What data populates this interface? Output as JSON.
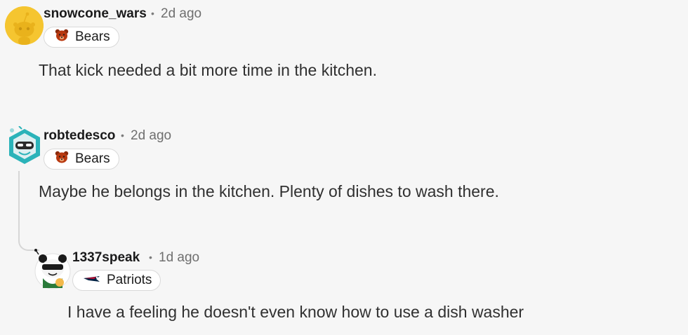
{
  "comments": [
    {
      "username": "snowcone_wars",
      "separator": "•",
      "time": "2d ago",
      "flair": {
        "label": "Bears",
        "icon": "bears-logo-icon",
        "color": "#c83803"
      },
      "body": "That kick needed a bit more time in the kitchen."
    },
    {
      "username": "robtedesco",
      "separator": "•",
      "time": "2d ago",
      "flair": {
        "label": "Bears",
        "icon": "bears-logo-icon",
        "color": "#c83803"
      },
      "body": "Maybe he belongs in the kitchen. Plenty of dishes to wash there."
    },
    {
      "username": "1337speak",
      "separator": "•",
      "time": "1d ago",
      "flair": {
        "label": "Patriots",
        "icon": "patriots-logo-icon",
        "color": "#002244"
      },
      "body": "I have a feeling he doesn't even know how to use a dish washer"
    }
  ],
  "colors": {
    "background": "#f6f6f6",
    "thread_line": "#d6d6d6",
    "avatar_yellow": "#f5c530",
    "avatar_teal": "#2bb3b9"
  }
}
